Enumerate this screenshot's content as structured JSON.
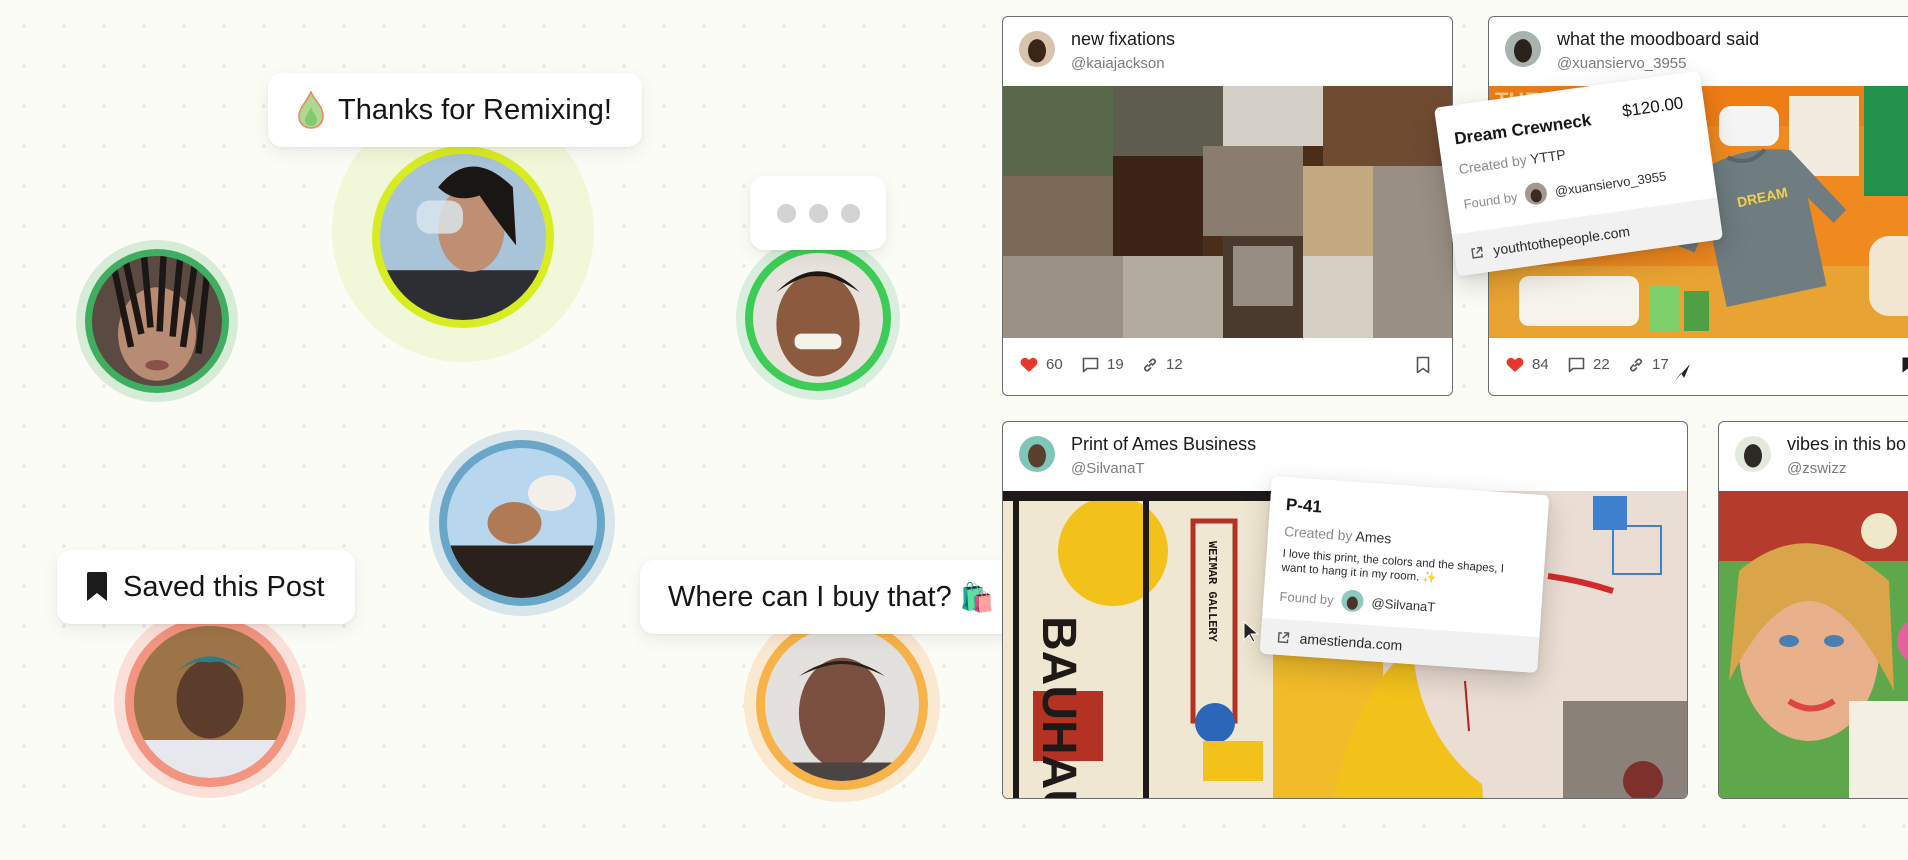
{
  "bubbles": {
    "remix": {
      "text": "Thanks for Remixing!",
      "icon": "flame-icon"
    },
    "saved": {
      "text": "Saved this Post",
      "icon": "bookmark-icon"
    },
    "buy": {
      "text": "Where can I buy that?",
      "emoji": "🛍️"
    },
    "typing": {
      "icon": "typing-indicator"
    }
  },
  "colors": {
    "background": "#fcfcf7",
    "like": "#e8372c",
    "ring_green": "#3cbf5b",
    "ring_lime": "#d6ec1f",
    "ring_blue": "#6aa6c8",
    "ring_salmon": "#f29480",
    "ring_orange": "#f7b24a"
  },
  "posts": [
    {
      "title": "new fixations",
      "handle": "@kaiajackson",
      "likes": "60",
      "comments": "19",
      "links": "12"
    },
    {
      "title": "what the moodboard said",
      "handle": "@xuansiervo_3955",
      "likes": "84",
      "comments": "22",
      "links": "17"
    },
    {
      "title": "Print of Ames Business",
      "handle": "@SilvanaT"
    },
    {
      "title": "vibes in this bo",
      "handle": "@zswizz"
    }
  ],
  "product_crewneck": {
    "name": "Dream Crewneck",
    "price": "$120.00",
    "created_by_label": "Created by",
    "created_by": "YTTP",
    "found_by_label": "Found by",
    "found_by": "@xuansiervo_3955",
    "link": "youthtothepeople.com"
  },
  "product_p41": {
    "name": "P-41",
    "created_by_label": "Created by",
    "created_by": "Ames",
    "description": "I love this print, the colors and the shapes, I want to hang it in my room. ✨",
    "found_by_label": "Found by",
    "found_by": "@SilvanaT",
    "link": "amestienda.com"
  },
  "image_text": {
    "yttp_banner": "THE YTTP",
    "bauhaus": "BAUHAUS",
    "weimar": "WEIMAR GALLERY"
  }
}
